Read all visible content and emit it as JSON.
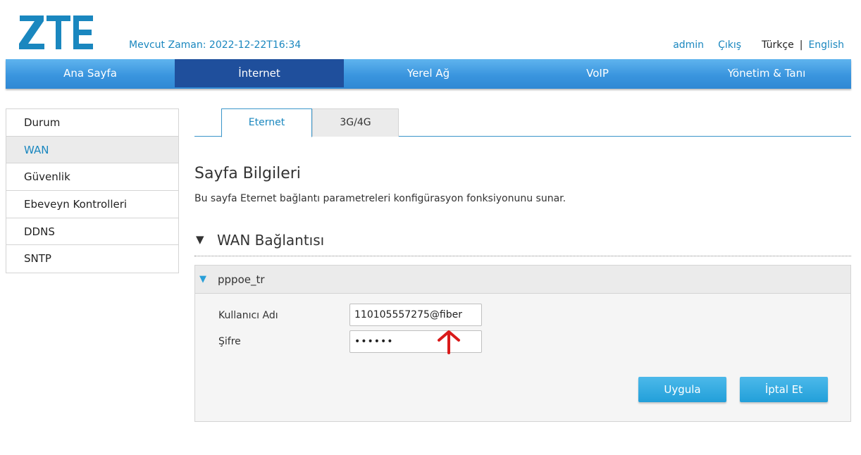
{
  "header": {
    "brand": "ZTE",
    "time_label": "Mevcut Zaman:",
    "time_value": "2022-12-22T16:34",
    "user": "admin",
    "logout": "Çıkış",
    "lang_current": "Türkçe",
    "lang_separator": "|",
    "lang_other": "English"
  },
  "nav": {
    "items": [
      {
        "label": "Ana Sayfa"
      },
      {
        "label": "İnternet"
      },
      {
        "label": "Yerel Ağ"
      },
      {
        "label": "VoIP"
      },
      {
        "label": "Yönetim & Tanı"
      }
    ],
    "active": "İnternet"
  },
  "sidebar": {
    "items": [
      {
        "label": "Durum"
      },
      {
        "label": "WAN"
      },
      {
        "label": "Güvenlik"
      },
      {
        "label": "Ebeveyn Kontrolleri"
      },
      {
        "label": "DDNS"
      },
      {
        "label": "SNTP"
      }
    ],
    "active": "WAN"
  },
  "tabs": {
    "items": [
      {
        "label": "Eternet"
      },
      {
        "label": "3G/4G"
      }
    ],
    "active": "Eternet"
  },
  "page": {
    "title": "Sayfa Bilgileri",
    "description": "Bu sayfa Eternet bağlantı parametreleri konfigürasyon fonksiyonunu sunar."
  },
  "section": {
    "title": "WAN Bağlantısı",
    "connection_name": "pppoe_tr",
    "username_label": "Kullanıcı Adı",
    "username_value": "110105557275@fiber",
    "password_label": "Şifre",
    "password_value": "••••••",
    "apply_label": "Uygula",
    "cancel_label": "İptal  Et"
  },
  "colors": {
    "brand_blue": "#1a87bf",
    "nav_active": "#1f4f9c",
    "button": "#229fd9",
    "annotation_arrow": "#d91a1a"
  },
  "icons": {
    "section_toggle": "triangle-down-icon",
    "panel_toggle": "triangle-down-icon",
    "annotation": "red-arrow-up-icon"
  }
}
